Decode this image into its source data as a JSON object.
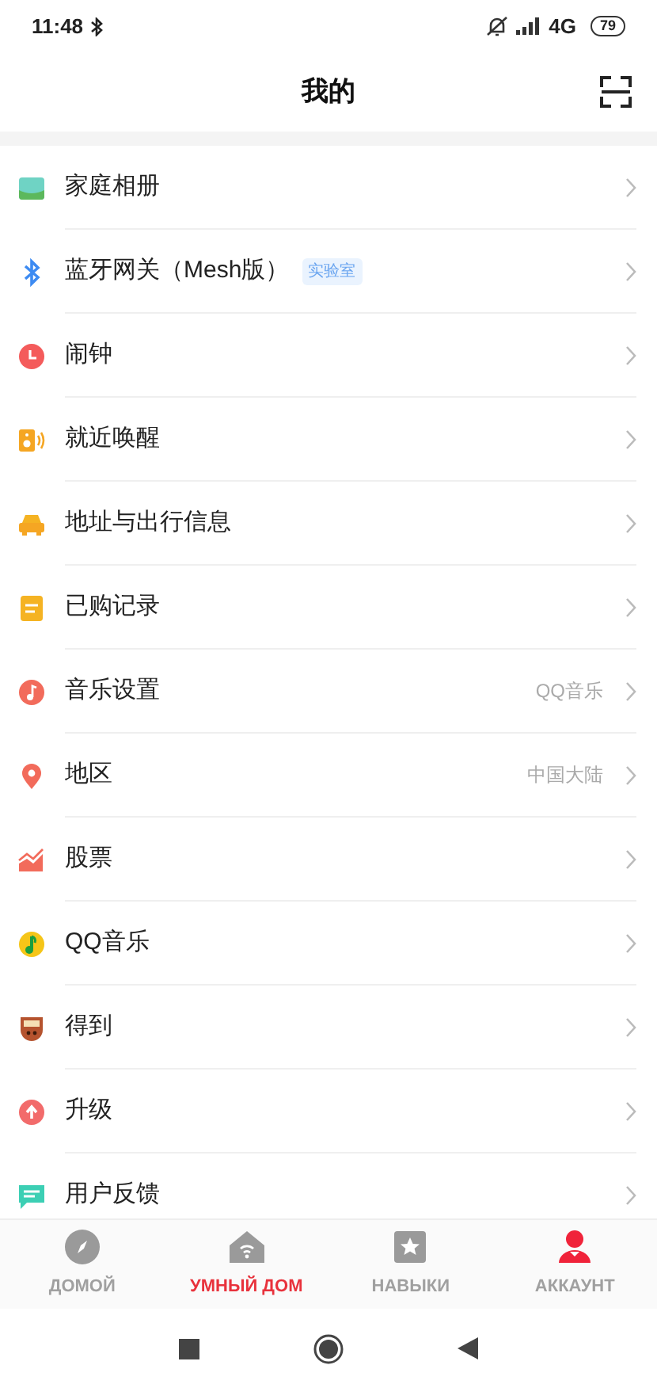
{
  "status_bar": {
    "time": "11:48",
    "network": "4G",
    "battery": "79"
  },
  "header": {
    "title": "我的"
  },
  "items": [
    {
      "kind": "album",
      "label": "家庭相册"
    },
    {
      "kind": "bluetooth",
      "label": "蓝牙网关（Mesh版）",
      "badge": "实验室"
    },
    {
      "kind": "alarm",
      "label": "闹钟"
    },
    {
      "kind": "speaker",
      "label": "就近唤醒"
    },
    {
      "kind": "car",
      "label": "地址与出行信息"
    },
    {
      "kind": "note",
      "label": "已购记录"
    },
    {
      "kind": "music",
      "label": "音乐设置",
      "value": "QQ音乐"
    },
    {
      "kind": "pin",
      "label": "地区",
      "value": "中国大陆"
    },
    {
      "kind": "stocks",
      "label": "股票"
    },
    {
      "kind": "qqmusic",
      "label": "QQ音乐"
    },
    {
      "kind": "shield",
      "label": "得到"
    },
    {
      "kind": "upgrade",
      "label": "升级"
    },
    {
      "kind": "feedback",
      "label": "用户反馈"
    }
  ],
  "tabs": [
    {
      "kind": "compass",
      "label": "ДОМОЙ",
      "selected": false,
      "icon_active": false
    },
    {
      "kind": "house",
      "label": "УМНЫЙ ДОМ",
      "selected": true,
      "icon_active": false
    },
    {
      "kind": "star",
      "label": "НАВЫКИ",
      "selected": false,
      "icon_active": false
    },
    {
      "kind": "person",
      "label": "АККАУНТ",
      "selected": false,
      "icon_active": true
    }
  ]
}
